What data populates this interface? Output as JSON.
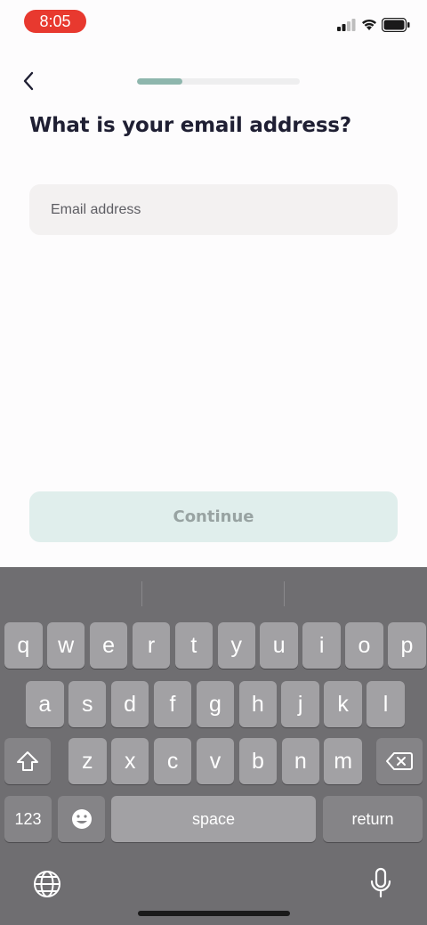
{
  "status_bar": {
    "time": "8:05",
    "icons": [
      "cellular-signal-icon",
      "wifi-icon",
      "battery-icon"
    ]
  },
  "nav": {
    "back_icon": "chevron-left-icon",
    "progress_fraction": 0.28
  },
  "heading": "What is your email address?",
  "email_field": {
    "placeholder": "Email address",
    "value": ""
  },
  "continue_button": {
    "label": "Continue",
    "enabled": false
  },
  "keyboard": {
    "row1": [
      "q",
      "w",
      "e",
      "r",
      "t",
      "y",
      "u",
      "i",
      "o",
      "p"
    ],
    "row2": [
      "a",
      "s",
      "d",
      "f",
      "g",
      "h",
      "j",
      "k",
      "l"
    ],
    "row3": [
      "z",
      "x",
      "c",
      "v",
      "b",
      "n",
      "m"
    ],
    "numbers_label": "123",
    "space_label": "space",
    "return_label": "return",
    "icons": [
      "shift-icon",
      "backspace-icon",
      "emoji-icon",
      "globe-icon",
      "microphone-icon"
    ]
  },
  "colors": {
    "accent": "#8eb6ad",
    "button_disabled_bg": "#e0eeec",
    "time_pill": "#e8392f"
  }
}
